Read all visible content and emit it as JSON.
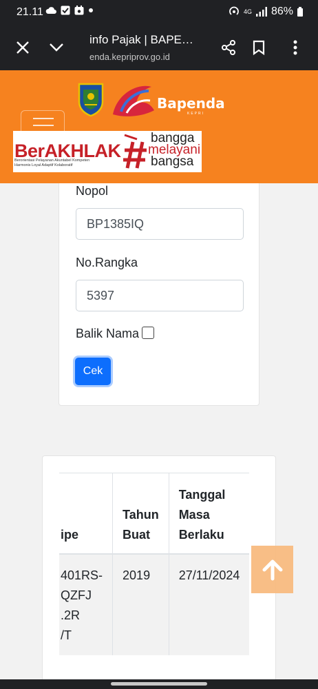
{
  "status_bar": {
    "time": "21.11",
    "network": "4G",
    "battery": "86%"
  },
  "browser": {
    "title": "info Pajak | BAPE…",
    "url": "enda.kepriprov.go.id",
    "icons": [
      "close-icon",
      "chevron-down-icon",
      "share-icon",
      "bookmark-icon",
      "more-vert-icon"
    ]
  },
  "header": {
    "brand": "Bapenda",
    "brand_sub": "KEPRI",
    "banner": {
      "title": "BerAKHLAK",
      "line1": "Berorientasi Pelayanan Akuntabel Kompeten",
      "line2": "Harmonis Loyal Adaptif Kolaboratif",
      "slogan1": "bangga",
      "slogan2": "melayani",
      "slogan3": "bangsa"
    },
    "colors": {
      "header_bg": "#f6821f",
      "banner_red": "#c62128"
    }
  },
  "form": {
    "nopol_label": "Nopol",
    "nopol_value": "BP1385IQ",
    "rangka_label": "No.Rangka",
    "rangka_value": "5397",
    "balik_nama_label": "Balik Nama",
    "balik_nama_checked": false,
    "submit_label": "Cek"
  },
  "result_table": {
    "headers": {
      "tipe": "ipe",
      "tahun": [
        "Tahun",
        "Buat"
      ],
      "tanggal": [
        "Tanggal",
        "Masa",
        "Berlaku"
      ]
    },
    "rows": [
      {
        "tipe": [
          "401RS-",
          "QZFJ",
          ".2R",
          "/T"
        ],
        "tahun": "2019",
        "tanggal": "27/11/2024"
      }
    ]
  },
  "scroll_top_icon": "arrow-up-icon",
  "accent": "#0d6efd"
}
